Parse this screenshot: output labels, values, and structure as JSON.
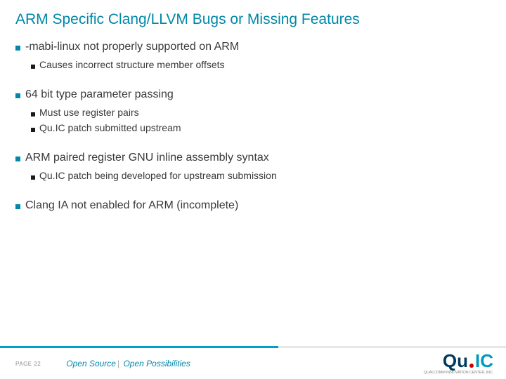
{
  "title": "ARM Specific Clang/LLVM Bugs or Missing Features",
  "groups": [
    {
      "heading": "-mabi-linux not properly supported on ARM",
      "items": [
        "Causes incorrect structure member offsets"
      ]
    },
    {
      "heading": "64 bit type parameter passing",
      "items": [
        "Must use register pairs",
        "Qu.IC patch submitted upstream"
      ]
    },
    {
      "heading": "ARM paired register GNU inline assembly syntax",
      "items": [
        "Qu.IC patch being developed for upstream submission"
      ]
    },
    {
      "heading": "Clang IA not enabled for ARM (incomplete)",
      "items": []
    }
  ],
  "footer": {
    "page": "PAGE 22",
    "tagline_a": "Open Source",
    "tagline_b": "Open Possibilities"
  },
  "logo": {
    "q": "Qu",
    "ic": "IC",
    "sub": "QUALCOMM INNOVATION CENTER, INC."
  }
}
